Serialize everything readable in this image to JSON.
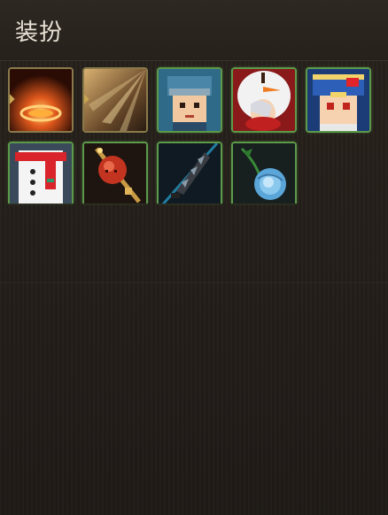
{
  "panel": {
    "title": "装扮"
  },
  "items_row1": [
    {
      "icon": "fire-ring-icon"
    },
    {
      "icon": "light-rays-icon"
    },
    {
      "icon": "headband-boy-avatar-icon"
    },
    {
      "icon": "snowman-hood-avatar-icon"
    },
    {
      "icon": "blue-hat-avatar-icon"
    }
  ],
  "items_row2": [
    {
      "icon": "snowman-costume-icon"
    },
    {
      "icon": "red-mace-weapon-icon"
    },
    {
      "icon": "dark-blade-weapon-icon"
    },
    {
      "icon": "blue-rose-icon"
    }
  ],
  "colors": {
    "background": "#221d19",
    "slot_border_green": "#5c9a4a",
    "slot_border_gold": "#8a7a4a",
    "title_text": "#e8e2d6"
  }
}
